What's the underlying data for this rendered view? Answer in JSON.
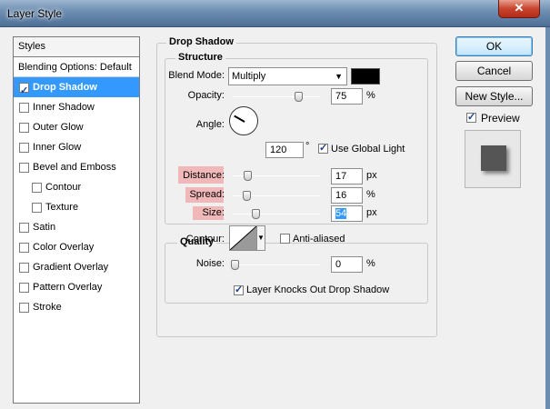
{
  "window": {
    "title": "Layer Style",
    "close_icon": "close-icon"
  },
  "styles_panel": {
    "header": "Styles",
    "blending_options": "Blending Options: Default",
    "items": [
      {
        "label": "Drop Shadow",
        "checked": true,
        "selected": true
      },
      {
        "label": "Inner Shadow",
        "checked": false
      },
      {
        "label": "Outer Glow",
        "checked": false
      },
      {
        "label": "Inner Glow",
        "checked": false
      },
      {
        "label": "Bevel and Emboss",
        "checked": false
      },
      {
        "label": "Contour",
        "checked": false,
        "indent": true
      },
      {
        "label": "Texture",
        "checked": false,
        "indent": true
      },
      {
        "label": "Satin",
        "checked": false
      },
      {
        "label": "Color Overlay",
        "checked": false
      },
      {
        "label": "Gradient Overlay",
        "checked": false
      },
      {
        "label": "Pattern Overlay",
        "checked": false
      },
      {
        "label": "Stroke",
        "checked": false
      }
    ]
  },
  "drop_shadow": {
    "title": "Drop Shadow",
    "structure": {
      "title": "Structure",
      "blend_mode_label": "Blend Mode:",
      "blend_mode_value": "Multiply",
      "blend_color": "#000000",
      "opacity_label": "Opacity:",
      "opacity_value": "75",
      "opacity_unit": "%",
      "angle_label": "Angle:",
      "angle_value": "120",
      "angle_unit": "°",
      "use_global_light_label": "Use Global Light",
      "use_global_light_checked": true,
      "distance_label": "Distance:",
      "distance_value": "17",
      "distance_unit": "px",
      "spread_label": "Spread:",
      "spread_value": "16",
      "spread_unit": "%",
      "size_label": "Size:",
      "size_value": "54",
      "size_unit": "px"
    },
    "quality": {
      "title": "Quality",
      "contour_label": "Contour:",
      "anti_aliased_label": "Anti-aliased",
      "anti_aliased_checked": false,
      "noise_label": "Noise:",
      "noise_value": "0",
      "noise_unit": "%"
    },
    "layer_knocks_out_label": "Layer Knocks Out Drop Shadow",
    "layer_knocks_out_checked": true
  },
  "buttons": {
    "ok": "OK",
    "cancel": "Cancel",
    "new_style": "New Style...",
    "preview_label": "Preview",
    "preview_checked": true
  }
}
